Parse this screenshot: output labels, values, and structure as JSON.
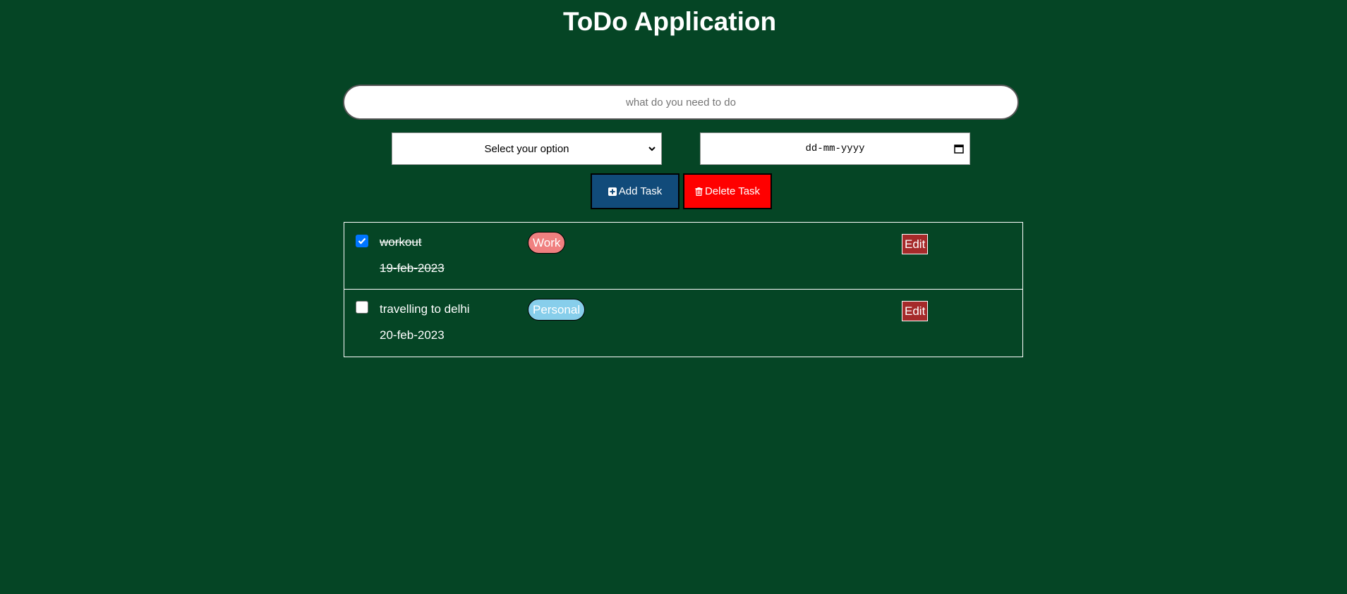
{
  "app": {
    "title": "ToDo Application"
  },
  "form": {
    "task_input": {
      "value": "",
      "placeholder": "what do you need to do"
    },
    "category_select": {
      "selected": "Select your option",
      "icon": "chevron-down-icon"
    },
    "date_input": {
      "value": "dd-mm-yyyy",
      "icon": "calendar-icon"
    }
  },
  "actions": {
    "add_label": "Add Task",
    "add_icon": "plus-square-icon",
    "delete_label": "Delete Task",
    "delete_icon": "trash-icon"
  },
  "tasks": [
    {
      "name": "workout",
      "date": "19-feb-2023",
      "category": "Work",
      "completed": true,
      "edit_label": "Edit"
    },
    {
      "name": "travelling to delhi",
      "date": "20-feb-2023",
      "category": "Personal",
      "completed": false,
      "edit_label": "Edit"
    }
  ],
  "colors": {
    "background": "#054525",
    "add_button": "#114b7a",
    "delete_button": "#ff0000",
    "edit_button": "#a52a2a",
    "tag_work": "#f08080",
    "tag_personal": "#87ceeb",
    "checkbox_checked": "#0075ff"
  }
}
